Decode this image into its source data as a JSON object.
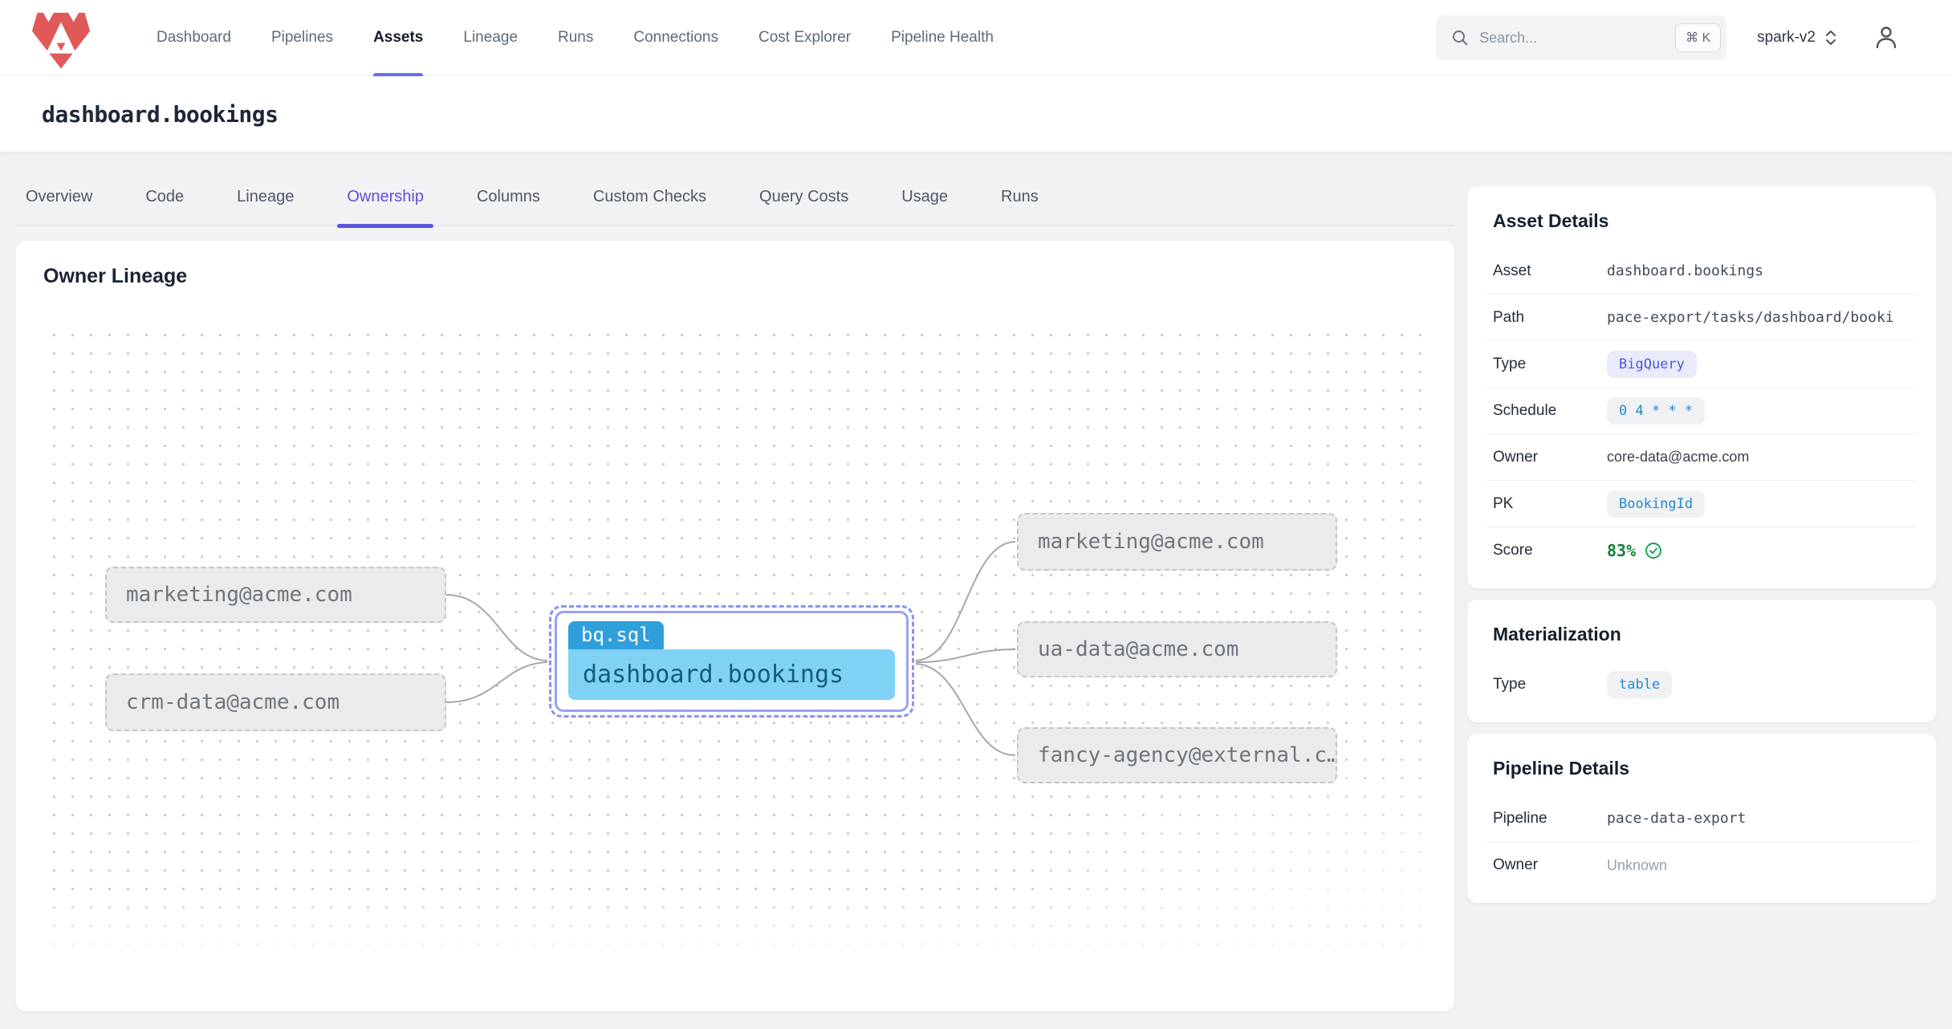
{
  "nav": {
    "items": [
      "Dashboard",
      "Pipelines",
      "Assets",
      "Lineage",
      "Runs",
      "Connections",
      "Cost Explorer",
      "Pipeline Health"
    ],
    "active": "Assets"
  },
  "header": {
    "search_placeholder": "Search...",
    "search_shortcut": "⌘ K",
    "environment": "spark-v2"
  },
  "page": {
    "title": "dashboard.bookings"
  },
  "tabs": {
    "items": [
      "Overview",
      "Code",
      "Lineage",
      "Ownership",
      "Columns",
      "Custom Checks",
      "Query Costs",
      "Usage",
      "Runs"
    ],
    "active": "Ownership"
  },
  "lineage": {
    "heading": "Owner Lineage",
    "upstream": [
      "marketing@acme.com",
      "crm-data@acme.com"
    ],
    "center": {
      "tag": "bq.sql",
      "label": "dashboard.bookings"
    },
    "downstream": [
      "marketing@acme.com",
      "ua-data@acme.com",
      "fancy-agency@external.c…"
    ]
  },
  "asset_details": {
    "heading": "Asset Details",
    "rows": [
      {
        "label": "Asset",
        "value": "dashboard.bookings"
      },
      {
        "label": "Path",
        "value": "pace-export/tasks/dashboard/booki"
      },
      {
        "label": "Type",
        "value": "BigQuery"
      },
      {
        "label": "Schedule",
        "value": "0 4 * * *"
      },
      {
        "label": "Owner",
        "value": "core-data@acme.com"
      },
      {
        "label": "PK",
        "value": "BookingId"
      },
      {
        "label": "Score",
        "value": "83%"
      }
    ]
  },
  "materialization": {
    "heading": "Materialization",
    "rows": [
      {
        "label": "Type",
        "value": "table"
      }
    ]
  },
  "pipeline_details": {
    "heading": "Pipeline Details",
    "rows": [
      {
        "label": "Pipeline",
        "value": "pace-data-export"
      },
      {
        "label": "Owner",
        "value": "Unknown"
      }
    ]
  },
  "colors": {
    "accent": "#5b55dd",
    "brand": "#e05858",
    "badge_indigo": "#4956e3",
    "badge_blue": "#2589c9",
    "node_fill": "#7fd2f6",
    "score_green": "#15803d"
  }
}
